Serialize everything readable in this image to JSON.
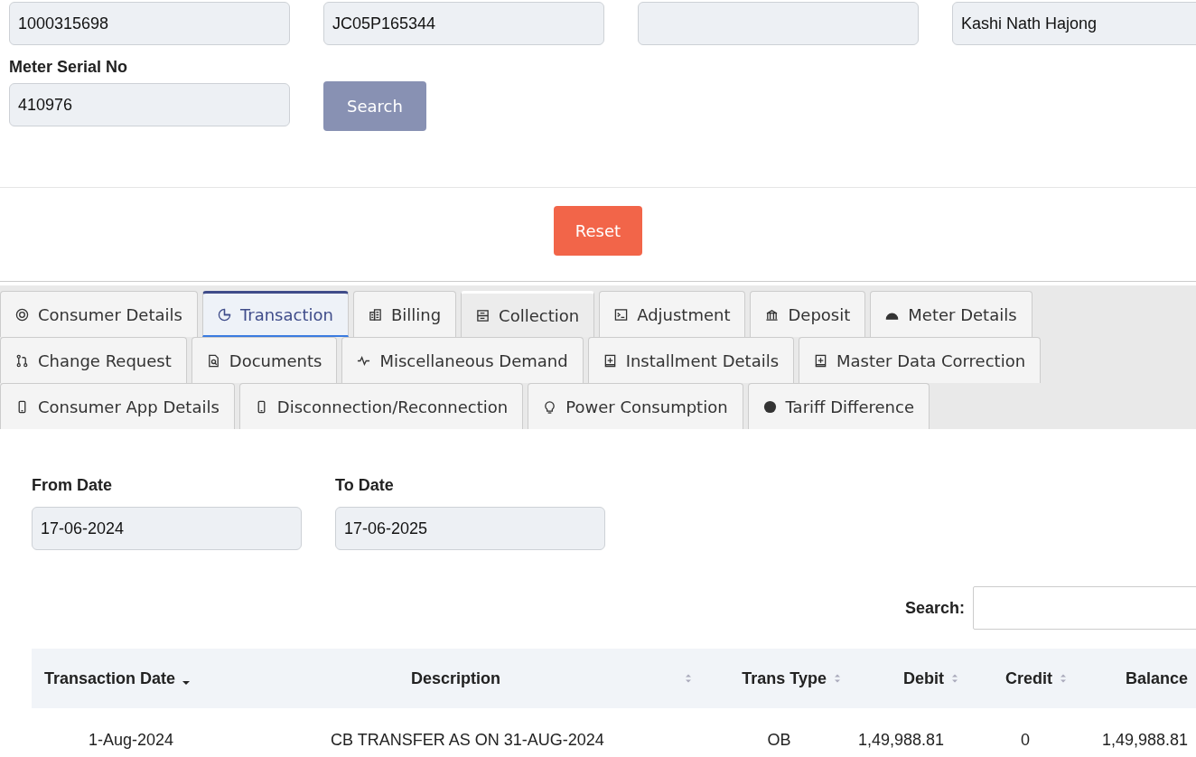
{
  "top_fields": [
    {
      "kind": "filled",
      "value": "1000315698"
    },
    {
      "kind": "filled",
      "value": "JC05P165344"
    },
    {
      "kind": "blank"
    },
    {
      "kind": "filled",
      "value": "Kashi Nath Hajong"
    }
  ],
  "meter_serial": {
    "label": "Meter Serial No",
    "value": "410976"
  },
  "search_button": "Search",
  "reset_button": "Reset",
  "tab_rows": [
    [
      {
        "label": "Consumer Details",
        "selected": false,
        "hovered": false
      },
      {
        "label": "Transaction",
        "selected": true,
        "hovered": false
      },
      {
        "label": "Billing",
        "selected": false,
        "hovered": false
      },
      {
        "label": "Collection",
        "selected": false,
        "hovered": true
      },
      {
        "label": "Adjustment",
        "selected": false,
        "hovered": false
      },
      {
        "label": "Deposit",
        "selected": false,
        "hovered": false
      },
      {
        "label": "Meter Details",
        "selected": false,
        "hovered": false
      }
    ],
    [
      {
        "label": "Change Request",
        "selected": false,
        "hovered": false
      },
      {
        "label": "Documents",
        "selected": false,
        "hovered": false
      },
      {
        "label": "Miscellaneous Demand",
        "selected": false,
        "hovered": false
      },
      {
        "label": "Installment Details",
        "selected": false,
        "hovered": false
      },
      {
        "label": "Master Data Correction",
        "selected": false,
        "hovered": false
      }
    ],
    [
      {
        "label": "Consumer App Details",
        "selected": false,
        "hovered": false
      },
      {
        "label": "Disconnection/Reconnection",
        "selected": false,
        "hovered": false
      },
      {
        "label": "Power Consumption",
        "selected": false,
        "hovered": false
      },
      {
        "label": "Tariff Difference",
        "selected": false,
        "hovered": false
      }
    ]
  ],
  "date_fields": [
    {
      "label": "From Date",
      "value": "17-06-2024"
    },
    {
      "label": "To Date",
      "value": "17-06-2025"
    }
  ],
  "table_search": {
    "label": "Search:"
  },
  "table": {
    "columns": [
      {
        "label": "Transaction Date",
        "sorted": true
      },
      {
        "label": "Description",
        "sorted": false
      },
      {
        "label": "Trans Type",
        "sorted": false
      },
      {
        "label": "Debit",
        "sorted": false
      },
      {
        "label": "Credit",
        "sorted": false
      },
      {
        "label": "Balance",
        "sorted": false
      }
    ],
    "rows": [
      [
        "1-Aug-2024",
        "CB TRANSFER AS ON 31-AUG-2024",
        "OB",
        "1,49,988.81",
        "0",
        "1,49,988.81"
      ]
    ]
  }
}
